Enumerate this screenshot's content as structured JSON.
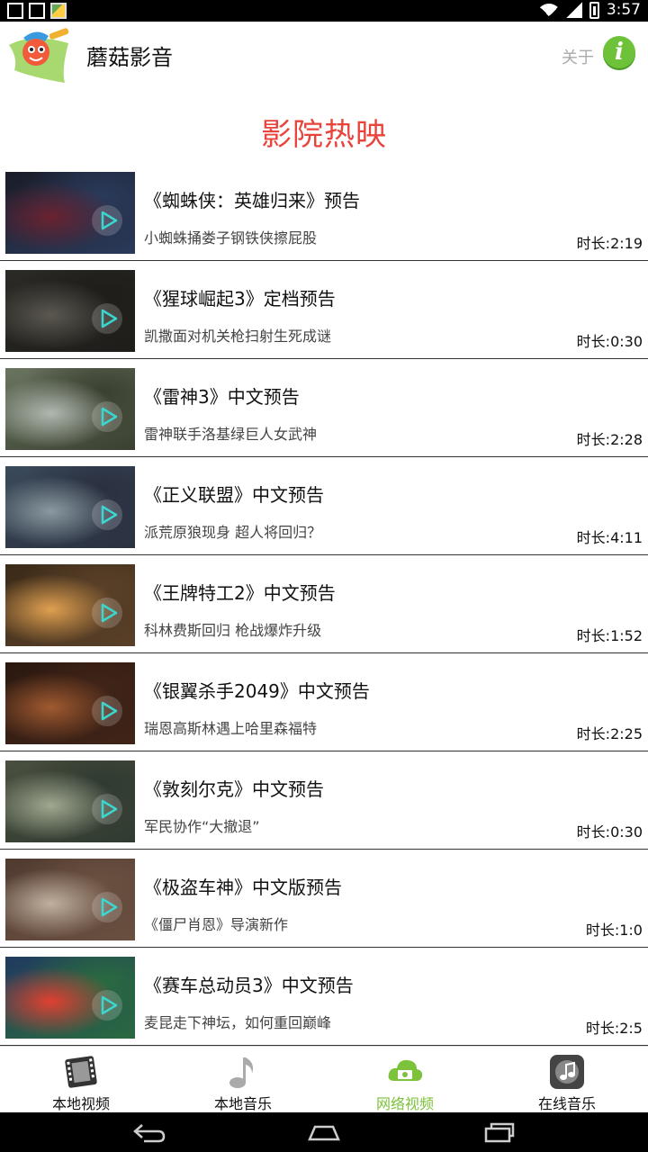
{
  "status_bar": {
    "time": "3:57"
  },
  "app": {
    "title": "蘑菇影音",
    "about_label": "关于",
    "info_icon_text": "i"
  },
  "section": {
    "title": "影院热映"
  },
  "videos": [
    {
      "title": "《蜘蛛侠：英雄归来》预告",
      "subtitle": "小蜘蛛捅娄子钢铁侠擦屁股",
      "duration": "时长:2:19",
      "thumb_colors": [
        "#1a1c28",
        "#6a2230",
        "#2a3a5a"
      ]
    },
    {
      "title": "《猩球崛起3》定档预告",
      "subtitle": "凯撒面对机关枪扫射生死成谜",
      "duration": "时长:0:30",
      "thumb_colors": [
        "#2c2a26",
        "#5a5850",
        "#1e1d1a"
      ]
    },
    {
      "title": "《雷神3》中文预告",
      "subtitle": "雷神联手洛基绿巨人女武神",
      "duration": "时长:2:28",
      "thumb_colors": [
        "#6a7560",
        "#b0b8b0",
        "#3a4030"
      ]
    },
    {
      "title": "《正义联盟》中文预告",
      "subtitle": "派荒原狼现身 超人将回归？",
      "duration": "时长:4:11",
      "thumb_colors": [
        "#3a4a5a",
        "#8a9aa0",
        "#2a3040"
      ]
    },
    {
      "title": "《王牌特工2》中文预告",
      "subtitle": "科林费斯回归 枪战爆炸升级",
      "duration": "时长:1:52",
      "thumb_colors": [
        "#3a2a18",
        "#e0a050",
        "#5a4028"
      ]
    },
    {
      "title": "《银翼杀手2049》中文预告",
      "subtitle": "瑞恩高斯林遇上哈里森福特",
      "duration": "时长:2:25",
      "thumb_colors": [
        "#2a1810",
        "#a05a30",
        "#402418"
      ]
    },
    {
      "title": "《敦刻尔克》中文预告",
      "subtitle": "军民协作“大撤退”",
      "duration": "时长:0:30",
      "thumb_colors": [
        "#4a5040",
        "#a0a890",
        "#303a30"
      ]
    },
    {
      "title": "《极盗车神》中文版预告",
      "subtitle": "《僵尸肖恩》导演新作",
      "duration": "时长:1:0",
      "thumb_colors": [
        "#503a30",
        "#c0b0a0",
        "#6a5040"
      ]
    },
    {
      "title": "《赛车总动员3》中文预告",
      "subtitle": "麦昆走下神坛，如何重回巅峰",
      "duration": "时长:2:5",
      "thumb_colors": [
        "#203a60",
        "#e04030",
        "#2a6a40"
      ]
    }
  ],
  "tabs": [
    {
      "label": "本地视频",
      "icon": "film-icon",
      "active": false
    },
    {
      "label": "本地音乐",
      "icon": "music-note-icon",
      "active": false
    },
    {
      "label": "网络视频",
      "icon": "cloud-video-icon",
      "active": true
    },
    {
      "label": "在线音乐",
      "icon": "online-music-icon",
      "active": false
    }
  ],
  "colors": {
    "accent": "#7cc23b",
    "section_title": "#e8443c",
    "info_button": "#6ec23a"
  }
}
